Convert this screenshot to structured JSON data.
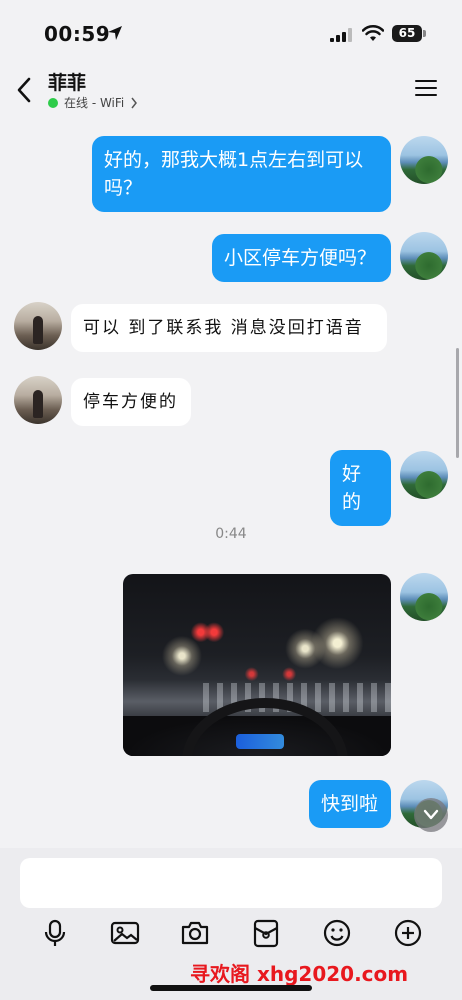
{
  "status_bar": {
    "time": "00:59",
    "battery": "65",
    "icons": [
      "location-arrow-icon",
      "signal-icon",
      "wifi-icon",
      "battery-icon"
    ]
  },
  "header": {
    "title": "菲菲",
    "presence": "在线 - WiFi",
    "presence_color": "#2ecc4a",
    "icons": [
      "back-icon",
      "menu-icon"
    ]
  },
  "colors": {
    "outgoing_bubble": "#1a9bf5",
    "incoming_bubble": "#ffffff",
    "background": "#f2f2f4"
  },
  "messages": [
    {
      "from": "me",
      "text": "好的，那我大概1点左右到可以吗？"
    },
    {
      "from": "me",
      "text": "小区停车方便吗？"
    },
    {
      "from": "friend",
      "text": "可以 到了联系我 消息没回打语音"
    },
    {
      "from": "friend",
      "text": "停车方便的"
    },
    {
      "from": "me",
      "text": "好的"
    },
    {
      "from": "system",
      "text": "0:44"
    },
    {
      "from": "me",
      "type": "image",
      "text": ""
    },
    {
      "from": "me",
      "text": "快到啦"
    }
  ],
  "composer": {
    "placeholder": "",
    "tools": [
      "microphone-icon",
      "image-icon",
      "camera-icon",
      "red-packet-icon",
      "emoji-icon",
      "plus-icon"
    ]
  },
  "watermark": "寻欢阁 xhg2020.com"
}
